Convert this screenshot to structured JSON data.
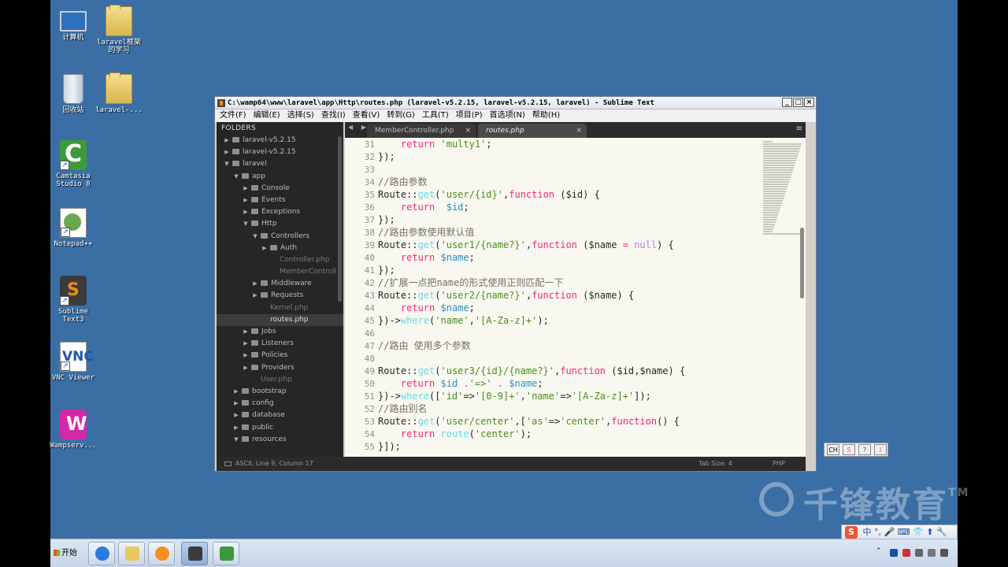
{
  "desktop": {
    "icons": [
      {
        "name": "computer",
        "label": "计算机"
      },
      {
        "name": "laravel-folder-1",
        "label": "laravel框架\n的学习"
      },
      {
        "name": "recycle-bin",
        "label": "回收站"
      },
      {
        "name": "laravel-folder-2",
        "label": "laravel-..."
      },
      {
        "name": "camtasia",
        "label": "Camtasia\nStudio 8"
      },
      {
        "name": "notepad",
        "label": "Notepad++"
      },
      {
        "name": "sublime",
        "label": "Sublime\nText3"
      },
      {
        "name": "vnc",
        "label": "VNC Viewer"
      },
      {
        "name": "wamp",
        "label": "Wampserv..."
      }
    ]
  },
  "window": {
    "title": "C:\\wamp64\\www\\laravel\\app\\Http\\routes.php (laravel-v5.2.15, laravel-v5.2.15, laravel) - Sublime Text",
    "buttons": {
      "minimize": "_",
      "maximize": "□",
      "close": "×"
    },
    "menu": [
      "文件(F)",
      "编辑(E)",
      "选择(S)",
      "查找(I)",
      "查看(V)",
      "转到(G)",
      "工具(T)",
      "项目(P)",
      "首选项(N)",
      "帮助(H)"
    ]
  },
  "sidebar": {
    "header": "FOLDERS",
    "items": [
      {
        "label": "laravel-v5.2.15",
        "depth": 0,
        "type": "folder",
        "open": false
      },
      {
        "label": "laravel-v5.2.15",
        "depth": 0,
        "type": "folder",
        "open": false
      },
      {
        "label": "laravel",
        "depth": 0,
        "type": "folder",
        "open": true
      },
      {
        "label": "app",
        "depth": 1,
        "type": "folder",
        "open": true
      },
      {
        "label": "Console",
        "depth": 2,
        "type": "folder",
        "open": false
      },
      {
        "label": "Events",
        "depth": 2,
        "type": "folder",
        "open": false
      },
      {
        "label": "Exceptions",
        "depth": 2,
        "type": "folder",
        "open": false
      },
      {
        "label": "Http",
        "depth": 2,
        "type": "folder",
        "open": true
      },
      {
        "label": "Controllers",
        "depth": 3,
        "type": "folder",
        "open": true
      },
      {
        "label": "Auth",
        "depth": 4,
        "type": "folder",
        "open": false
      },
      {
        "label": "Controller.php",
        "depth": 4,
        "type": "file"
      },
      {
        "label": "MemberControll",
        "depth": 4,
        "type": "file"
      },
      {
        "label": "Middleware",
        "depth": 3,
        "type": "folder",
        "open": false
      },
      {
        "label": "Requests",
        "depth": 3,
        "type": "folder",
        "open": false
      },
      {
        "label": "Kernel.php",
        "depth": 3,
        "type": "file"
      },
      {
        "label": "routes.php",
        "depth": 3,
        "type": "file",
        "selected": true
      },
      {
        "label": "Jobs",
        "depth": 2,
        "type": "folder",
        "open": false
      },
      {
        "label": "Listeners",
        "depth": 2,
        "type": "folder",
        "open": false
      },
      {
        "label": "Policies",
        "depth": 2,
        "type": "folder",
        "open": false
      },
      {
        "label": "Providers",
        "depth": 2,
        "type": "folder",
        "open": false
      },
      {
        "label": "User.php",
        "depth": 2,
        "type": "file"
      },
      {
        "label": "bootstrap",
        "depth": 1,
        "type": "folder",
        "open": false
      },
      {
        "label": "config",
        "depth": 1,
        "type": "folder",
        "open": false
      },
      {
        "label": "database",
        "depth": 1,
        "type": "folder",
        "open": false
      },
      {
        "label": "public",
        "depth": 1,
        "type": "folder",
        "open": false
      },
      {
        "label": "resources",
        "depth": 1,
        "type": "folder",
        "open": true
      }
    ]
  },
  "tabs": [
    {
      "label": "MemberController.php",
      "active": false,
      "close": "×"
    },
    {
      "label": "routes.php",
      "active": true,
      "close": "×"
    }
  ],
  "tab_nav": "◀ ▶",
  "tab_menu": "≡",
  "code": [
    {
      "n": "31",
      "t": [
        [
          "    ",
          ""
        ],
        [
          "return",
          "kw"
        ],
        [
          " ",
          ""
        ],
        [
          "'multy1'",
          "str"
        ],
        [
          ";",
          ""
        ]
      ]
    },
    {
      "n": "32",
      "t": [
        [
          "});",
          ""
        ]
      ]
    },
    {
      "n": "33",
      "t": []
    },
    {
      "n": "34",
      "t": [
        [
          "//路由参数",
          "cmt"
        ]
      ]
    },
    {
      "n": "35",
      "t": [
        [
          "Route",
          ""
        ],
        [
          "::",
          ""
        ],
        [
          "get",
          "fn"
        ],
        [
          "(",
          ""
        ],
        [
          "'user/{id}'",
          "str"
        ],
        [
          ",",
          ""
        ],
        [
          "function",
          "kw"
        ],
        [
          " ($id) {",
          ""
        ]
      ]
    },
    {
      "n": "36",
      "t": [
        [
          "    ",
          ""
        ],
        [
          "return",
          "kw"
        ],
        [
          "  ",
          ""
        ],
        [
          "$id",
          "var"
        ],
        [
          ";",
          ""
        ]
      ]
    },
    {
      "n": "37",
      "t": [
        [
          "});",
          ""
        ]
      ]
    },
    {
      "n": "38",
      "t": [
        [
          "//路由参数使用默认值",
          "cmt"
        ]
      ]
    },
    {
      "n": "39",
      "t": [
        [
          "Route",
          ""
        ],
        [
          "::",
          ""
        ],
        [
          "get",
          "fn"
        ],
        [
          "(",
          ""
        ],
        [
          "'user1/{name?}'",
          "str"
        ],
        [
          ",",
          ""
        ],
        [
          "function",
          "kw"
        ],
        [
          " ($name ",
          ""
        ],
        [
          "=",
          "kw"
        ],
        [
          " ",
          ""
        ],
        [
          "null",
          "num"
        ],
        [
          ") {",
          ""
        ]
      ]
    },
    {
      "n": "40",
      "t": [
        [
          "    ",
          ""
        ],
        [
          "return",
          "kw"
        ],
        [
          " ",
          ""
        ],
        [
          "$name",
          "var"
        ],
        [
          ";",
          ""
        ]
      ]
    },
    {
      "n": "41",
      "t": [
        [
          "});",
          ""
        ]
      ]
    },
    {
      "n": "42",
      "t": [
        [
          "//扩展一点把name的形式使用正则匹配一下",
          "cmt"
        ]
      ]
    },
    {
      "n": "43",
      "t": [
        [
          "Route",
          ""
        ],
        [
          "::",
          ""
        ],
        [
          "get",
          "fn"
        ],
        [
          "(",
          ""
        ],
        [
          "'user2/{name?}'",
          "str"
        ],
        [
          ",",
          ""
        ],
        [
          "function",
          "kw"
        ],
        [
          " ($name) {",
          ""
        ]
      ]
    },
    {
      "n": "44",
      "t": [
        [
          "    ",
          ""
        ],
        [
          "return",
          "kw"
        ],
        [
          " ",
          ""
        ],
        [
          "$name",
          "var"
        ],
        [
          ";",
          ""
        ]
      ]
    },
    {
      "n": "45",
      "t": [
        [
          "})",
          ""
        ],
        [
          "->",
          ""
        ],
        [
          "where",
          "fn"
        ],
        [
          "(",
          ""
        ],
        [
          "'name'",
          "str"
        ],
        [
          ",",
          ""
        ],
        [
          "'[A-Za-z]+'",
          "str"
        ],
        [
          ");",
          ""
        ]
      ]
    },
    {
      "n": "46",
      "t": []
    },
    {
      "n": "47",
      "t": [
        [
          "//路由 使用多个参数",
          "cmt"
        ]
      ]
    },
    {
      "n": "48",
      "t": []
    },
    {
      "n": "49",
      "t": [
        [
          "Route",
          ""
        ],
        [
          "::",
          ""
        ],
        [
          "get",
          "fn"
        ],
        [
          "(",
          ""
        ],
        [
          "'user3/{id}/{name?}'",
          "str"
        ],
        [
          ",",
          ""
        ],
        [
          "function",
          "kw"
        ],
        [
          " ($id,$name) {",
          ""
        ]
      ]
    },
    {
      "n": "50",
      "t": [
        [
          "    ",
          ""
        ],
        [
          "return",
          "kw"
        ],
        [
          " ",
          ""
        ],
        [
          "$id",
          "var"
        ],
        [
          " ",
          ""
        ],
        [
          ".",
          "kw"
        ],
        [
          "'=>'",
          "str"
        ],
        [
          " ",
          ""
        ],
        [
          ".",
          "kw"
        ],
        [
          " ",
          ""
        ],
        [
          "$name",
          "var"
        ],
        [
          ";",
          ""
        ]
      ]
    },
    {
      "n": "51",
      "t": [
        [
          "})",
          ""
        ],
        [
          "->",
          ""
        ],
        [
          "where",
          "fn"
        ],
        [
          "([",
          ""
        ],
        [
          "'id'",
          "str"
        ],
        [
          "=>",
          ""
        ],
        [
          "'[0-9]+'",
          "str"
        ],
        [
          ",",
          ""
        ],
        [
          "'name'",
          "str"
        ],
        [
          "=>",
          ""
        ],
        [
          "'[A-Za-z]+'",
          "str"
        ],
        [
          "]);",
          ""
        ]
      ]
    },
    {
      "n": "52",
      "t": [
        [
          "//路由别名",
          "cmt"
        ]
      ]
    },
    {
      "n": "53",
      "t": [
        [
          "Route",
          ""
        ],
        [
          "::",
          ""
        ],
        [
          "get",
          "fn"
        ],
        [
          "(",
          ""
        ],
        [
          "'user/center'",
          "str"
        ],
        [
          ",[",
          ""
        ],
        [
          "'as'",
          "str"
        ],
        [
          "=>",
          ""
        ],
        [
          "'center'",
          "str"
        ],
        [
          ",",
          ""
        ],
        [
          "function",
          "kw"
        ],
        [
          "() {",
          ""
        ]
      ]
    },
    {
      "n": "54",
      "t": [
        [
          "    ",
          ""
        ],
        [
          "return",
          "kw"
        ],
        [
          " ",
          ""
        ],
        [
          "route",
          "fn"
        ],
        [
          "(",
          ""
        ],
        [
          "'center'",
          "str"
        ],
        [
          ");",
          ""
        ]
      ]
    },
    {
      "n": "55",
      "t": [
        [
          "}]);",
          ""
        ]
      ]
    }
  ],
  "statusbar": {
    "left": "ASCII, Line 9, Column 17",
    "tabsize": "Tab Size: 4",
    "syntax": "PHP"
  },
  "ime_small": [
    "CH",
    "S",
    "?",
    "⁝"
  ],
  "watermark": {
    "text": "千锋教育",
    "tm": "TM"
  },
  "ime_bar": {
    "logo": "S",
    "text": "中 °, 🎤 ⌨ 👕 ⬆ 🔧"
  },
  "taskbar": {
    "start": "开始",
    "buttons": [
      "ie",
      "explorer",
      "media",
      "sublime",
      "camtasia"
    ]
  },
  "tray": {
    "expand": "⌃"
  }
}
